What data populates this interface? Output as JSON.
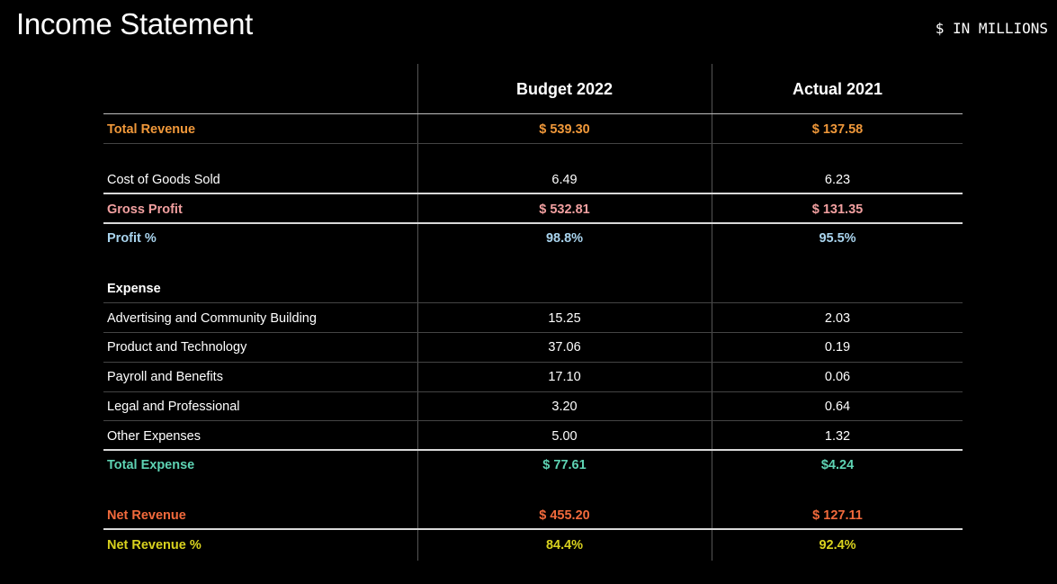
{
  "title": "Income Statement",
  "units": "$ IN MILLIONS",
  "columns": [
    "Budget 2022",
    "Actual 2021"
  ],
  "colors": {
    "revenue": "#f0983a",
    "gross": "#f2a0a0",
    "profit_pct": "#a9d4ee",
    "total_expense": "#5ed3b3",
    "net_revenue": "#f26a3c",
    "net_pct": "#d9d21e",
    "default": "#ffffff"
  },
  "rows": {
    "total_revenue": {
      "label": "Total Revenue",
      "budget": "$ 539.30",
      "actual": "$ 137.58"
    },
    "cogs": {
      "label": "Cost of Goods Sold",
      "budget": "6.49",
      "actual": "6.23"
    },
    "gross_profit": {
      "label": "Gross Profit",
      "budget": "$ 532.81",
      "actual": "$ 131.35"
    },
    "profit_pct": {
      "label": "Profit %",
      "budget": "98.8%",
      "actual": "95.5%"
    },
    "expense_header": {
      "label": "Expense"
    },
    "advertising": {
      "label": "Advertising and Community Building",
      "budget": "15.25",
      "actual": "2.03"
    },
    "product_tech": {
      "label": "Product and Technology",
      "budget": "37.06",
      "actual": "0.19"
    },
    "payroll": {
      "label": "Payroll and Benefits",
      "budget": "17.10",
      "actual": "0.06"
    },
    "legal": {
      "label": "Legal and Professional",
      "budget": "3.20",
      "actual": "0.64"
    },
    "other": {
      "label": "Other Expenses",
      "budget": "5.00",
      "actual": "1.32"
    },
    "total_expense": {
      "label": "Total Expense",
      "budget": "$ 77.61",
      "actual": "$4.24"
    },
    "net_revenue": {
      "label": "Net Revenue",
      "budget": "$ 455.20",
      "actual": "$ 127.11"
    },
    "net_revenue_pct": {
      "label": "Net Revenue %",
      "budget": "84.4%",
      "actual": "92.4%"
    }
  }
}
